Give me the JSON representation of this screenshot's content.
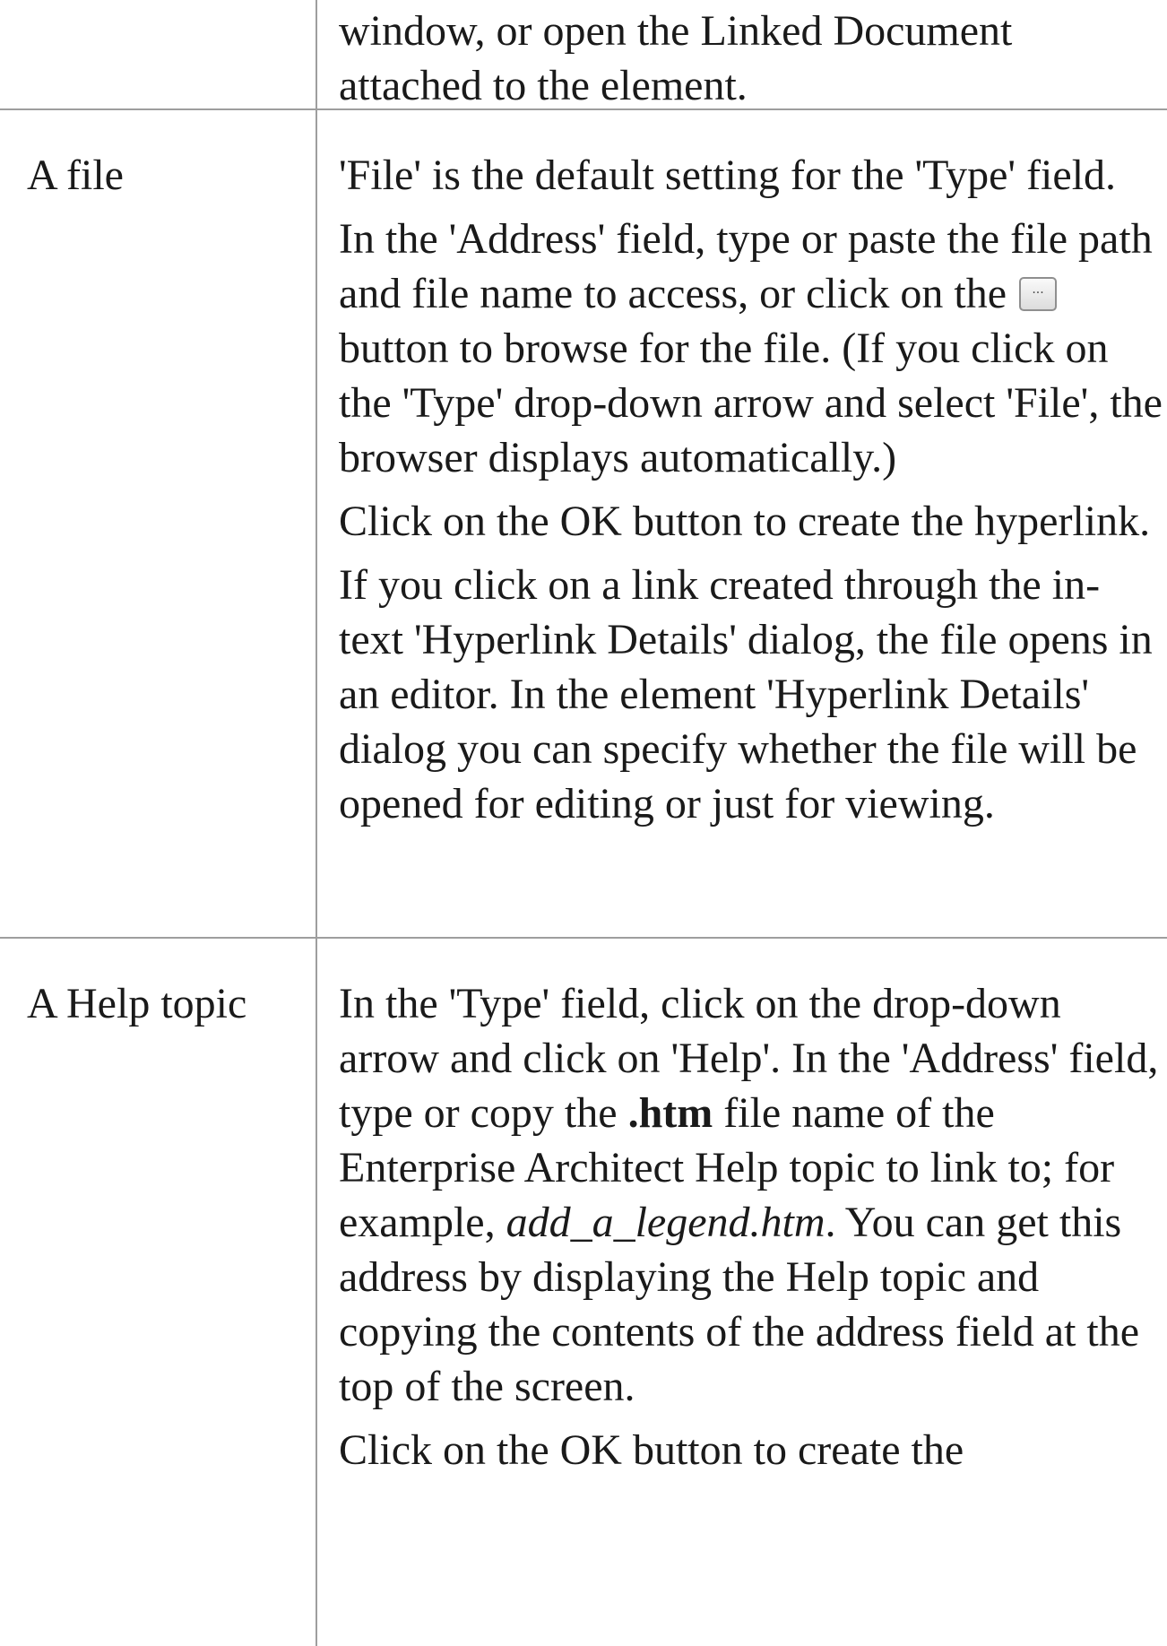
{
  "rows": [
    {
      "label": "",
      "paragraphs": [
        "window, or open the Linked Document attached to the element."
      ]
    },
    {
      "label": "A file",
      "p1": "'File' is the default setting for the 'Type' field.",
      "p2_before": "In the 'Address' field, type or paste the file path and file name to access, or click on the",
      "p2_after": "button to browse for the file. (If you click on the 'Type' drop-down arrow and select 'File', the browser displays automatically.)",
      "p3": "Click on the OK button to create the hyperlink.",
      "p4": "If you click on a link created through the in-text 'Hyperlink Details' dialog, the file opens in an editor. In the element 'Hyperlink Details' dialog you can specify whether the file will be opened for editing or just for viewing."
    },
    {
      "label": "A Help topic",
      "p1_before": "In the 'Type' field, click on the drop-down arrow and click on 'Help'. In the 'Address' field, type or copy the",
      "p1_bold": ".htm",
      "p1_mid": "file name of the Enterprise Architect Help topic to link to; for example,",
      "p1_italic": "add_a_legend.htm",
      "p1_after": ". You can get this address by displaying the Help topic and copying the contents of the address field at the top of the screen.",
      "p2": "Click on the OK button to create the"
    }
  ],
  "icons": {
    "browse_button": "ellipsis-button-icon"
  }
}
